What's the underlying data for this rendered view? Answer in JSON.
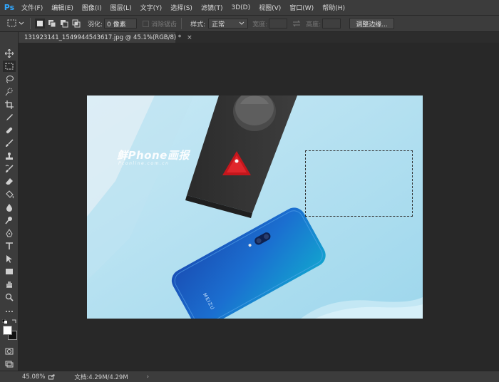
{
  "app": {
    "logo": "Ps"
  },
  "menu": [
    "文件(F)",
    "编辑(E)",
    "图像(I)",
    "图层(L)",
    "文字(Y)",
    "选择(S)",
    "滤镜(T)",
    "3D(D)",
    "视图(V)",
    "窗口(W)",
    "帮助(H)"
  ],
  "options": {
    "feather_label": "羽化:",
    "feather_value": "0 像素",
    "antialias_label": "消除锯齿",
    "style_label": "样式:",
    "style_value": "正常",
    "width_label": "宽度:",
    "height_label": "高度:",
    "refine_label": "调整边缘..."
  },
  "document": {
    "tab_title": "131923141_1549944543617.jpg @ 45.1%(RGB/8) *",
    "close": "×"
  },
  "image": {
    "watermark_main": "鲜Phone画报",
    "watermark_sub": "Pconline.com.cn",
    "phone_brand": "MEIZU"
  },
  "status": {
    "zoom": "45.08%",
    "doc_info": "文档:4.29M/4.29M",
    "arrow": "›"
  },
  "colors": {
    "ui_bg": "#3c3c3c",
    "canvas_bg": "#282828",
    "image_bg": "#a9dcef",
    "ps_blue": "#31a8ff"
  }
}
